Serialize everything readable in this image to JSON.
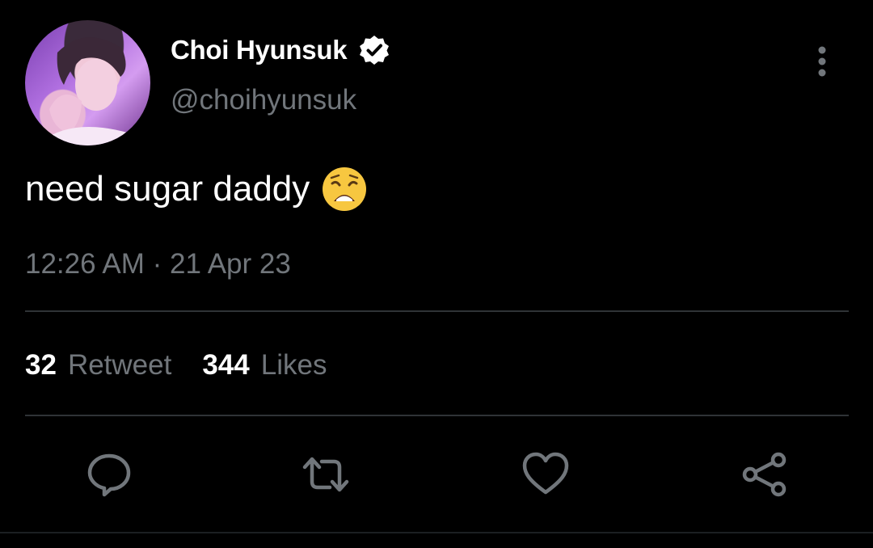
{
  "author": {
    "display_name": "Choi Hyunsuk",
    "handle": "@choihyunsuk",
    "verified": true
  },
  "tweet": {
    "text": "need sugar daddy",
    "emoji": "weary-face",
    "timestamp": "12:26 AM · 21 Apr 23"
  },
  "stats": {
    "retweets": "32",
    "retweets_label": "Retweet",
    "likes": "344",
    "likes_label": "Likes"
  },
  "actions": [
    "reply-icon",
    "retweet-icon",
    "like-icon",
    "share-icon"
  ],
  "colors": {
    "background": "#000000",
    "text_primary": "#ffffff",
    "text_secondary": "#71767b",
    "divider": "#2f3336",
    "emoji_yellow": "#f7c740"
  }
}
